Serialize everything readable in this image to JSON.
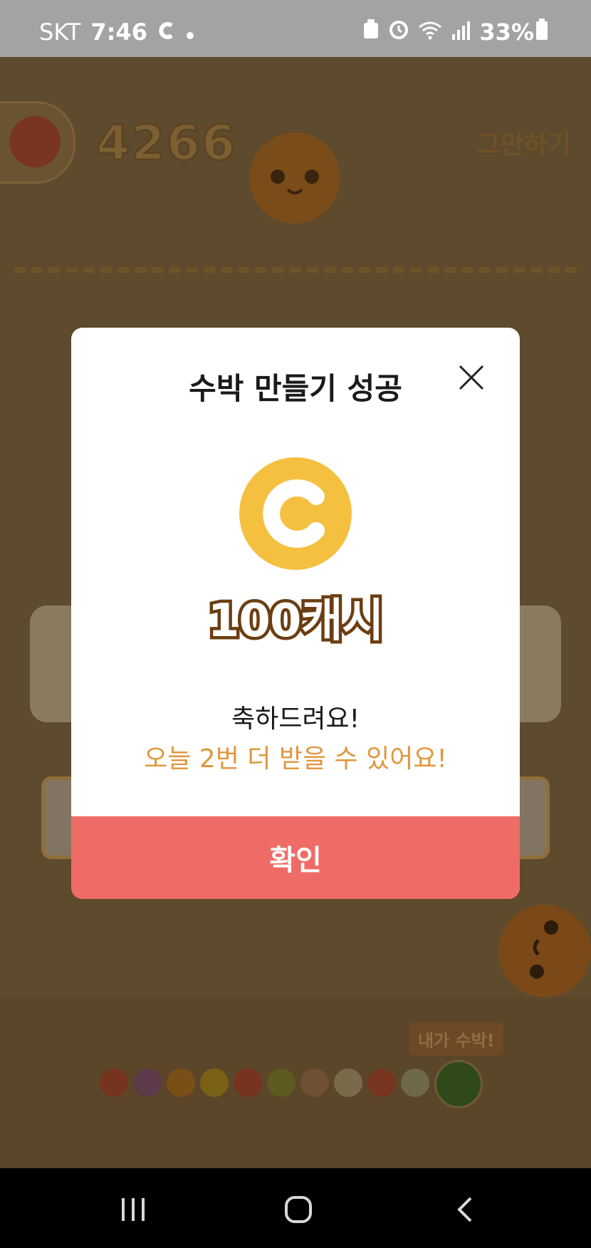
{
  "status_bar": {
    "carrier": "SKT",
    "time": "7:46",
    "battery": "33%"
  },
  "game": {
    "score": "4266",
    "quit_label": "그만하기",
    "tooltip": "내가 수박!"
  },
  "modal": {
    "title": "수박 만들기 성공",
    "reward": "100캐시",
    "message": "축하드려요!",
    "sub_message": "오늘 2번 더 받을 수 있어요!",
    "confirm_label": "확인"
  },
  "colors": {
    "accent_orange": "#e0973d",
    "confirm_button": "#ef6b65",
    "coin": "#f5c040",
    "reward_outline": "#6b3e12"
  },
  "icons": {
    "close": "close-icon",
    "coin": "cash-coin-icon",
    "recent_apps": "recent-apps-icon",
    "home": "home-icon",
    "back": "back-icon"
  }
}
